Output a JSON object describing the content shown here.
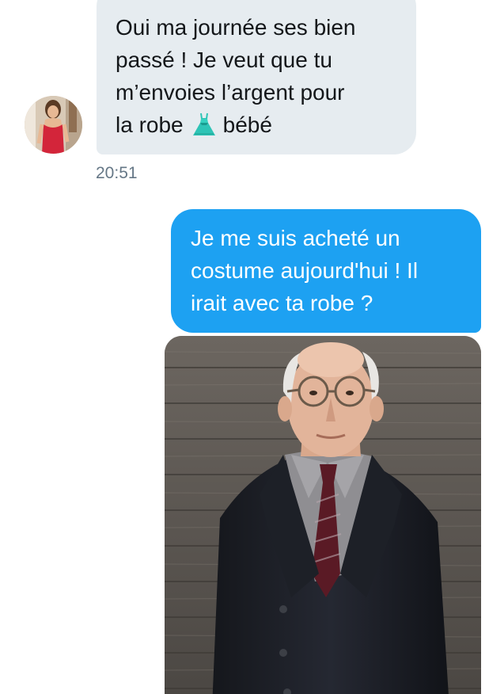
{
  "conversation": {
    "incoming": {
      "lines": [
        "Oui ma journée ses bien",
        "passé ! Je veut que tu",
        "m’envoies l’argent pour"
      ],
      "last_line_before_icon": "la robe",
      "last_line_after_icon": "bébé",
      "icon": "dress-emoji-icon",
      "timestamp": "20:51",
      "bubble_color": "#e6ecf0"
    },
    "outgoing": {
      "lines": [
        "Je me suis acheté un",
        "costume aujourd'hui ! Il",
        "irait avec ta robe ?"
      ],
      "bubble_color": "#1da1f2",
      "attachment": "photo-man-in-suit"
    }
  }
}
